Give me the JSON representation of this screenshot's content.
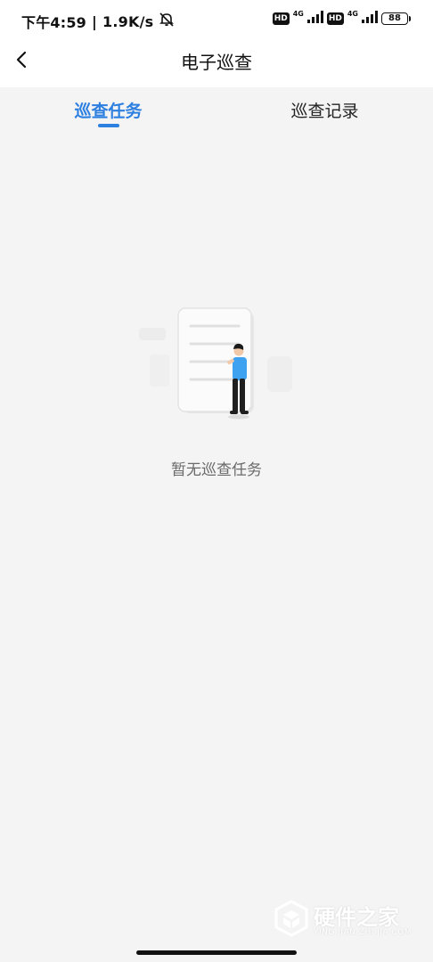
{
  "status_bar": {
    "time": "下午4:59",
    "network_speed": "1.9K/s",
    "separator": "|",
    "sim1_badge": "HD",
    "sim1_network": "4G",
    "sim2_badge": "HD",
    "sim2_network": "4G",
    "battery": "88",
    "icons": [
      "mute-off-icon",
      "signal-icon",
      "signal-icon",
      "battery-icon"
    ]
  },
  "navbar": {
    "title": "电子巡查",
    "back_icon": "chevron-left-icon"
  },
  "tabs": [
    {
      "label": "巡查任务",
      "active": true
    },
    {
      "label": "巡查记录",
      "active": false
    }
  ],
  "empty_state": {
    "message": "暂无巡查任务",
    "illustration": "person-with-document-illustration"
  },
  "watermark": {
    "title": "硬件之家",
    "subtitle": "YING JIAN ZHI JIA.COM"
  },
  "colors": {
    "accent": "#2d7fe0",
    "background": "#f4f4f4",
    "text_primary": "#111111",
    "text_secondary": "#6a6a6a",
    "person_shirt": "#3fa2f0",
    "person_pants": "#1f1f1f"
  }
}
